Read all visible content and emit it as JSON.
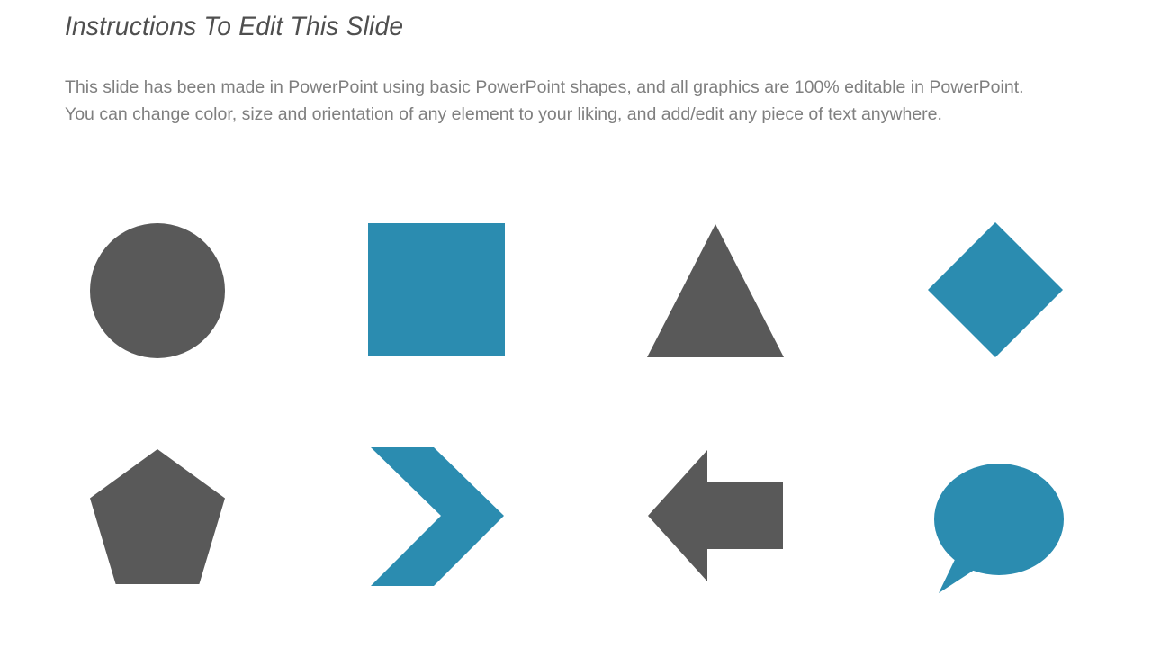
{
  "slide": {
    "title": "Instructions To Edit This Slide",
    "paragraph_1": "This slide has been made in PowerPoint using basic PowerPoint shapes, and all graphics are 100% editable in PowerPoint.",
    "paragraph_2": "You can change color, size and orientation of any element to your liking, and add/edit any piece of text anywhere."
  },
  "colors": {
    "background": "#ffffff",
    "title_text": "#4f4f4f",
    "body_text": "#7f7f7f",
    "shape_gray": "#595959",
    "shape_blue": "#2b8cb0"
  },
  "shapes": [
    {
      "name": "circle",
      "color": "#595959",
      "row": 1,
      "column": 1
    },
    {
      "name": "square",
      "color": "#2b8cb0",
      "row": 1,
      "column": 2
    },
    {
      "name": "triangle",
      "color": "#595959",
      "row": 1,
      "column": 3
    },
    {
      "name": "diamond",
      "color": "#2b8cb0",
      "row": 1,
      "column": 4
    },
    {
      "name": "pentagon",
      "color": "#595959",
      "row": 2,
      "column": 1
    },
    {
      "name": "chevron",
      "color": "#2b8cb0",
      "row": 2,
      "column": 2
    },
    {
      "name": "arrow-left",
      "color": "#595959",
      "row": 2,
      "column": 3
    },
    {
      "name": "speech-bubble",
      "color": "#2b8cb0",
      "row": 2,
      "column": 4
    }
  ]
}
